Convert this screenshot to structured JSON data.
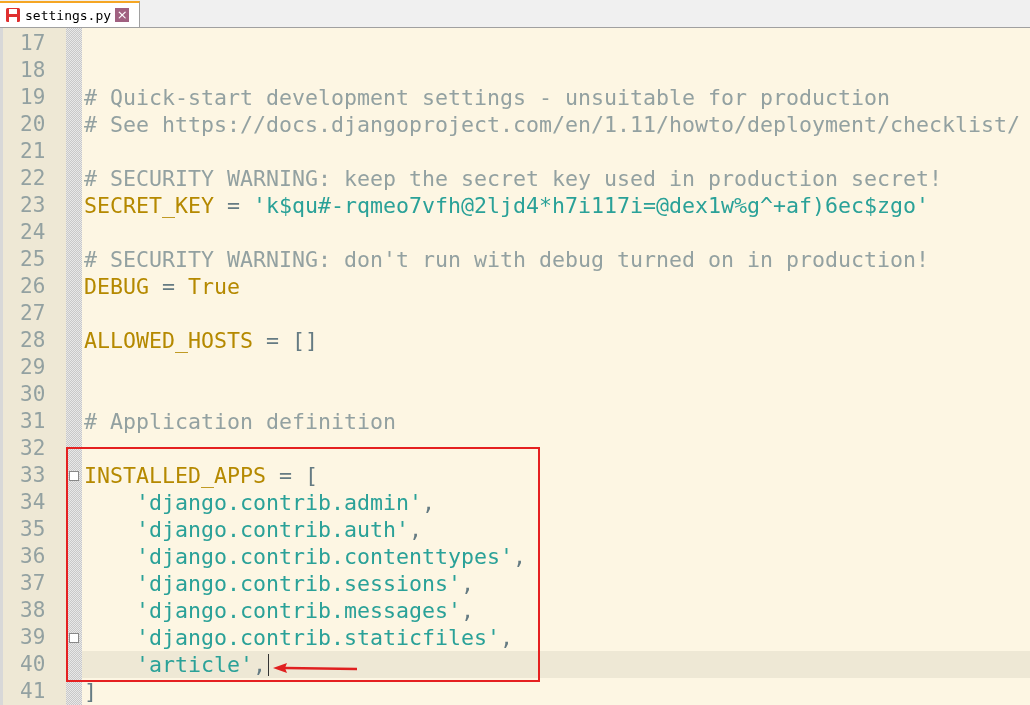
{
  "tab": {
    "label": "settings.py",
    "close": "×"
  },
  "lines": [
    {
      "number": "17",
      "current": false,
      "fold": false
    },
    {
      "number": "18",
      "current": false,
      "fold": false
    },
    {
      "number": "19",
      "tokens": [
        {
          "kind": "comment",
          "text": "# Quick-start development settings - unsuitable for production"
        }
      ],
      "current": false,
      "fold": false
    },
    {
      "number": "20",
      "tokens": [
        {
          "kind": "comment",
          "text": "# See https://docs.djangoproject.com/en/1.11/howto/deployment/checklist/"
        }
      ],
      "current": false,
      "fold": false
    },
    {
      "number": "21",
      "current": false,
      "fold": false
    },
    {
      "number": "22",
      "tokens": [
        {
          "kind": "comment",
          "text": "# SECURITY WARNING: keep the secret key used in production secret!"
        }
      ],
      "current": false,
      "fold": false
    },
    {
      "number": "23",
      "tokens": [
        {
          "kind": "name",
          "text": "SECRET_KEY"
        },
        {
          "kind": "op",
          "text": " = "
        },
        {
          "kind": "string",
          "text": "'k$qu#-rqmeo7vfh@2ljd4*h7i117i=@dex1w%g^+af)6ec$zgo'"
        }
      ],
      "current": false,
      "fold": false
    },
    {
      "number": "24",
      "current": false,
      "fold": false
    },
    {
      "number": "25",
      "tokens": [
        {
          "kind": "comment",
          "text": "# SECURITY WARNING: don't run with debug turned on in production!"
        }
      ],
      "current": false,
      "fold": false
    },
    {
      "number": "26",
      "tokens": [
        {
          "kind": "name",
          "text": "DEBUG"
        },
        {
          "kind": "op",
          "text": " = "
        },
        {
          "kind": "name",
          "text": "True"
        }
      ],
      "current": false,
      "fold": false
    },
    {
      "number": "27",
      "current": false,
      "fold": false
    },
    {
      "number": "28",
      "tokens": [
        {
          "kind": "name",
          "text": "ALLOWED_HOSTS"
        },
        {
          "kind": "op",
          "text": " = []"
        }
      ],
      "current": false,
      "fold": false
    },
    {
      "number": "29",
      "current": false,
      "fold": false
    },
    {
      "number": "30",
      "current": false,
      "fold": false
    },
    {
      "number": "31",
      "tokens": [
        {
          "kind": "comment",
          "text": "# Application definition"
        }
      ],
      "current": false,
      "fold": false
    },
    {
      "number": "32",
      "current": false,
      "fold": false
    },
    {
      "number": "33",
      "tokens": [
        {
          "kind": "name",
          "text": "INSTALLED_APPS"
        },
        {
          "kind": "op",
          "text": " = ["
        }
      ],
      "current": false,
      "fold": true
    },
    {
      "number": "34",
      "tokens": [
        {
          "kind": "string",
          "text": "    'django.contrib.admin'"
        },
        {
          "kind": "op",
          "text": ","
        }
      ],
      "current": false,
      "fold": false
    },
    {
      "number": "35",
      "tokens": [
        {
          "kind": "string",
          "text": "    'django.contrib.auth'"
        },
        {
          "kind": "op",
          "text": ","
        }
      ],
      "current": false,
      "fold": false
    },
    {
      "number": "36",
      "tokens": [
        {
          "kind": "string",
          "text": "    'django.contrib.contenttypes'"
        },
        {
          "kind": "op",
          "text": ","
        }
      ],
      "current": false,
      "fold": false
    },
    {
      "number": "37",
      "tokens": [
        {
          "kind": "string",
          "text": "    'django.contrib.sessions'"
        },
        {
          "kind": "op",
          "text": ","
        }
      ],
      "current": false,
      "fold": false
    },
    {
      "number": "38",
      "tokens": [
        {
          "kind": "string",
          "text": "    'django.contrib.messages'"
        },
        {
          "kind": "op",
          "text": ","
        }
      ],
      "current": false,
      "fold": false
    },
    {
      "number": "39",
      "tokens": [
        {
          "kind": "string",
          "text": "    'django.contrib.staticfiles'"
        },
        {
          "kind": "op",
          "text": ","
        }
      ],
      "current": false,
      "fold": true
    },
    {
      "number": "40",
      "tokens": [
        {
          "kind": "string",
          "text": "    'article'"
        },
        {
          "kind": "op",
          "text": ","
        }
      ],
      "current": true,
      "fold": false
    },
    {
      "number": "41",
      "tokens": [
        {
          "kind": "op",
          "text": "]"
        }
      ],
      "current": false,
      "fold": false
    }
  ]
}
